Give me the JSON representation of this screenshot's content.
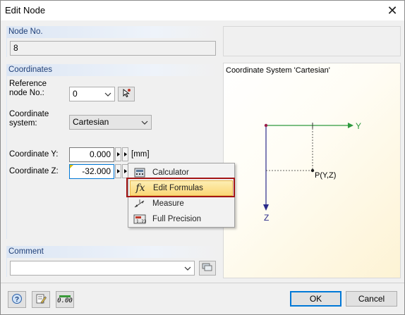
{
  "window": {
    "title": "Edit Node"
  },
  "node": {
    "header": "Node No.",
    "value": "8"
  },
  "coordinates": {
    "header": "Coordinates",
    "ref_label_1": "Reference",
    "ref_label_2": "node No.:",
    "ref_value": "0",
    "sys_label_1": "Coordinate",
    "sys_label_2": "system:",
    "sys_value": "Cartesian",
    "y_label": "Coordinate Y:",
    "y_value": "0.000",
    "z_label": "Coordinate Z:",
    "z_value": "-32.000",
    "unit": "[mm]"
  },
  "context_menu": {
    "items": [
      {
        "label": "Calculator",
        "icon": "calculator-icon"
      },
      {
        "label": "Edit Formulas",
        "icon": "fx-icon",
        "active": true
      },
      {
        "label": "Measure",
        "icon": "measure-icon"
      },
      {
        "label": "Full Precision",
        "icon": "precision-icon"
      }
    ],
    "fx_glyph": "fx"
  },
  "comment": {
    "header": "Comment",
    "value": ""
  },
  "preview": {
    "title": "Coordinate System 'Cartesian'",
    "y_axis": "Y",
    "z_axis": "Z",
    "point_label": "P(Y,Z)",
    "colors": {
      "y_axis": "#2e9a3e",
      "z_axis": "#2a2a8a",
      "origin": "#9a1e4a"
    }
  },
  "footer": {
    "ok_label": "OK",
    "cancel_label": "Cancel",
    "precision_glyph": "0.00"
  }
}
